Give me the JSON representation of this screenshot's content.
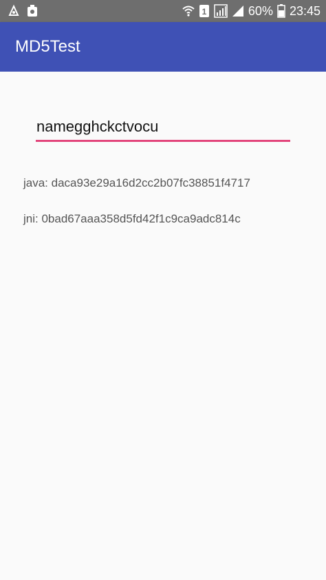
{
  "status_bar": {
    "battery_percent": "60%",
    "time": "23:45",
    "sim_slot": "1"
  },
  "app_bar": {
    "title": "MD5Test"
  },
  "input": {
    "value": "namegghckctvocu"
  },
  "results": {
    "java": "java: daca93e29a16d2cc2b07fc38851f4717",
    "jni": "jni: 0bad67aaa358d5fd42f1c9ca9adc814c"
  },
  "colors": {
    "app_bar": "#3f51b5",
    "accent": "#e2457b",
    "status_bar": "#6e6e6e",
    "background": "#fafafa"
  }
}
